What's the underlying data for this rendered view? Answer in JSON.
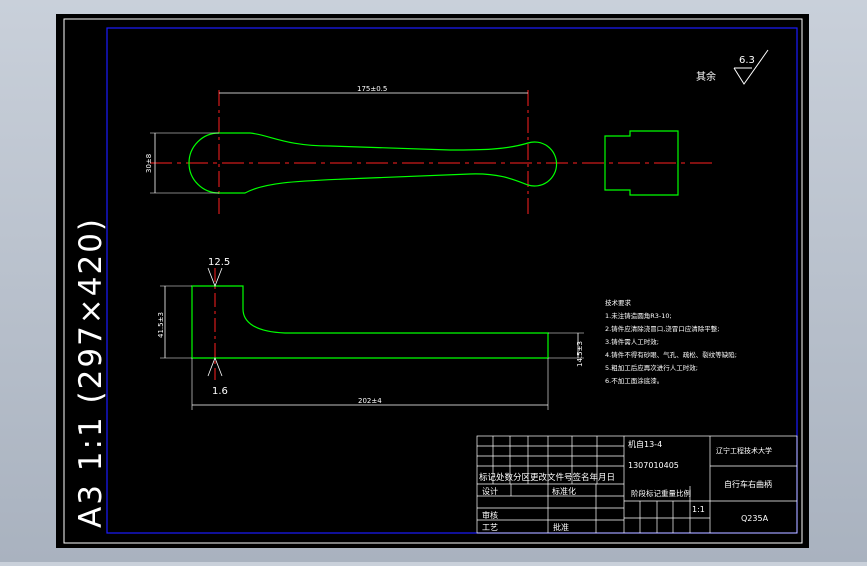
{
  "sheet": {
    "vertical_title": "A3 1:1 (297×420)",
    "roughness_value": "6.3",
    "roughness_note": "其余"
  },
  "top_view": {
    "length_dim": "175±0.5",
    "height_dim": "30±8"
  },
  "side_view": {
    "top_dim": "12.5",
    "bottom_dim": "1.6",
    "left_height_dim": "41.5±3",
    "right_height_dim": "14.5±3",
    "length_dim": "202±4"
  },
  "tech_requirements": {
    "title": "技术要求",
    "items": [
      "1.未注铸造圆角R3-10;",
      "2.铸件应清除浇冒口,浇冒口应清除平整;",
      "3.铸件需人工时效;",
      "4.铸件不得有砂眼、气孔、疏松、裂纹等缺陷;",
      "5.粗加工后应再次进行人工时效;",
      "6.不加工面涂底漆。"
    ]
  },
  "title_block": {
    "class_name": "机自13-4",
    "student_id": "1307010405",
    "school": "辽宁工程技术大学",
    "part_name": "自行车右曲柄",
    "material": "Q235A",
    "row_headers": "标记处数分区更改文件号签名年月日",
    "design": "设计",
    "standardization": "标准化",
    "review": "审核",
    "process": "工艺",
    "approve": "批准",
    "stage_mark": "阶段标记重量比例",
    "scale": "1:1"
  },
  "colors": {
    "sheet_bg": "#000000",
    "outline": "#00ff00",
    "centerline": "#ff0000",
    "frame": "#0000ff",
    "text": "#ffffff"
  }
}
